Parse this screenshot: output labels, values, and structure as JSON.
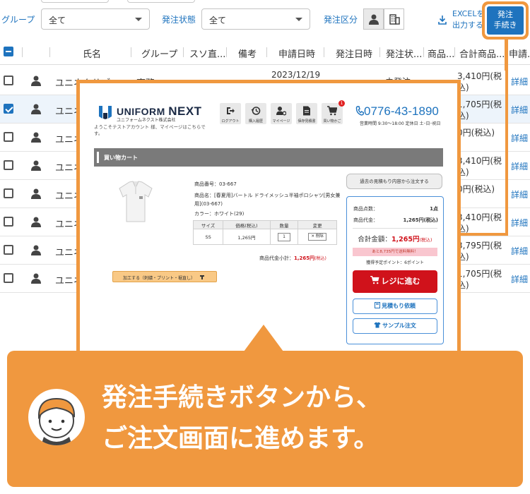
{
  "filters": {
    "group_label": "グループ",
    "group_value": "全て",
    "order_status_label": "発注状態",
    "order_status_value": "全て",
    "order_type_label": "発注区分",
    "excel_line1": "EXCELを",
    "excel_line2": "出力する",
    "order_button_line1": "発注",
    "order_button_line2": "手続き"
  },
  "table": {
    "columns": [
      "氏名",
      "グループ",
      "スソ直...",
      "備考",
      "申請日時",
      "発注日時",
      "発注状...",
      "商品...",
      "合計商品...",
      "申請..."
    ],
    "rows": [
      {
        "name": "ユニネクサブ",
        "group": "事務",
        "date": "2023/12/19",
        "status": "未発注",
        "amount": "3,410円(税込)",
        "detail": "詳細",
        "selected": false
      },
      {
        "name": "ユニネ",
        "group": "",
        "date": "",
        "status": "",
        "amount": "1,705円(税込)",
        "detail": "詳細",
        "selected": true
      },
      {
        "name": "ユニネ",
        "group": "",
        "date": "",
        "status": "",
        "amount": "0円(税込)",
        "detail": "詳細",
        "selected": false
      },
      {
        "name": "ユニネ",
        "group": "",
        "date": "",
        "status": "",
        "amount": "3,410円(税込)",
        "detail": "詳細",
        "selected": false
      },
      {
        "name": "ユニネ",
        "group": "",
        "date": "",
        "status": "",
        "amount": "0円(税込)",
        "detail": "詳細",
        "selected": false
      },
      {
        "name": "ユニネ",
        "group": "",
        "date": "",
        "status": "",
        "amount": "3,410円(税込)",
        "detail": "詳細",
        "selected": false
      },
      {
        "name": "ユニネ",
        "group": "",
        "date": "",
        "status": "",
        "amount": "3,795円(税込)",
        "detail": "詳細",
        "selected": false
      },
      {
        "name": "ユニネ",
        "group": "",
        "date": "",
        "status": "",
        "amount": "1,705円(税込)",
        "detail": "詳細",
        "selected": false
      }
    ]
  },
  "shop": {
    "logo_en_a": "UNIFORM ",
    "logo_en_b": "NEXT",
    "logo_jp": "ユニフォームネクスト株式会社",
    "welcome": "ようこそテストアカウント 様、マイページはこちらです。",
    "nav": [
      {
        "label": "ログアウト",
        "icon": "logout-icon"
      },
      {
        "label": "購入履歴",
        "icon": "history-icon"
      },
      {
        "label": "マイページ",
        "icon": "user-gear-icon"
      },
      {
        "label": "保存見積書",
        "icon": "document-icon"
      },
      {
        "label": "買い物かご",
        "icon": "cart-icon"
      }
    ],
    "cart_count": "1",
    "phone": "0776-43-1890",
    "hours": "営業時間 9:30～18:00  定休日 土･日･祝日",
    "cart_title": "買い物カート",
    "product_code": "商品番号：03-667",
    "product_name": "商品名：[春夏用]バートル ドライメッシュ半袖ポロシャツ[男女兼用](03-667)",
    "product_color": "カラー：ホワイト(29)",
    "table_headers": [
      "サイズ",
      "価格(税込)",
      "数量",
      "変更"
    ],
    "size": "SS",
    "price": "1,265円",
    "qty": "1",
    "delete_label": "削除",
    "subtotal_label": "商品代金小計：",
    "subtotal_value": "1,265円",
    "tax_note": "(税込)",
    "processing_button": "加工する（刺繍・プリント・裾直し）",
    "past_quote_button": "過去の見積もり内容から注文する",
    "item_count_label": "商品点数：",
    "item_count_value": "1点",
    "item_price_label": "商品代金：",
    "item_price_value": "1,265円(税込)",
    "total_label": "合計金額：",
    "total_value": "1,265円",
    "shipping_note": "あと8,735円で送料無料！",
    "points_note": "獲得予定ポイント：6ポイント",
    "register_button": "レジに進む",
    "quote_button": "見積もり依頼",
    "sample_button": "サンプル注文"
  },
  "callout": {
    "line1": "発注手続きボタンから、",
    "line2": "ご注文画面に進めます。"
  },
  "colors": {
    "accent_orange": "#f0983f",
    "primary_blue": "#1e73be",
    "register_red": "#d0121b"
  }
}
